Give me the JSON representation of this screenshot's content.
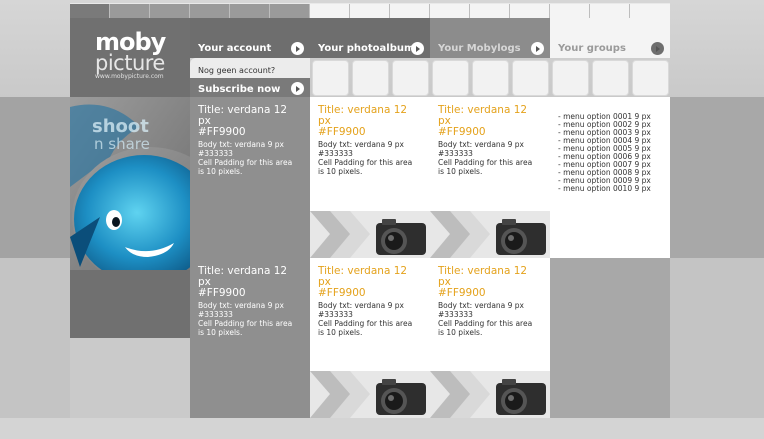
{
  "logo": {
    "line1": "moby",
    "line2": "picture",
    "url": "www.mobypicture.com",
    "tagline1": "shoot",
    "tagline2": "n share"
  },
  "nav": {
    "items": [
      {
        "label": "Your account",
        "icon": "arrow-right-icon"
      },
      {
        "label": "Your photoalbum",
        "icon": "arrow-right-icon"
      },
      {
        "label": "Your Mobylogs",
        "icon": "arrow-right-icon"
      },
      {
        "label": "Your groups",
        "icon": "arrow-right-icon"
      }
    ]
  },
  "account": {
    "no_account": "Nog geen account?",
    "subscribe": "Subscribe now"
  },
  "cells": {
    "title_line1": "Title: verdana 12 px",
    "title_line2": "#FF9900",
    "body_line1": "Body txt: verdana 9 px",
    "body_line2": "#333333",
    "body_line3": "Cell Padding for this area",
    "body_line4": "is 10 pixels."
  },
  "menu": {
    "items": [
      "- menu option 0001 9 px",
      "- menu option 0002 9 px",
      "- menu option 0003 9 px",
      "- menu option 0004 9 px",
      "- menu option 0005 9 px",
      "- menu option 0006 9 px",
      "- menu option 0007 9 px",
      "- menu option 0008 9 px",
      "- menu option 0009 9 px",
      "- menu option 0010 9 px"
    ]
  },
  "colors": {
    "accent": "#FF9900",
    "title_orange": "#e4a21c",
    "body_text": "#333333",
    "nav_dark": "#6e6e6e",
    "nav_mid": "#8c8c8c",
    "nav_light": "#f4f4f4"
  }
}
